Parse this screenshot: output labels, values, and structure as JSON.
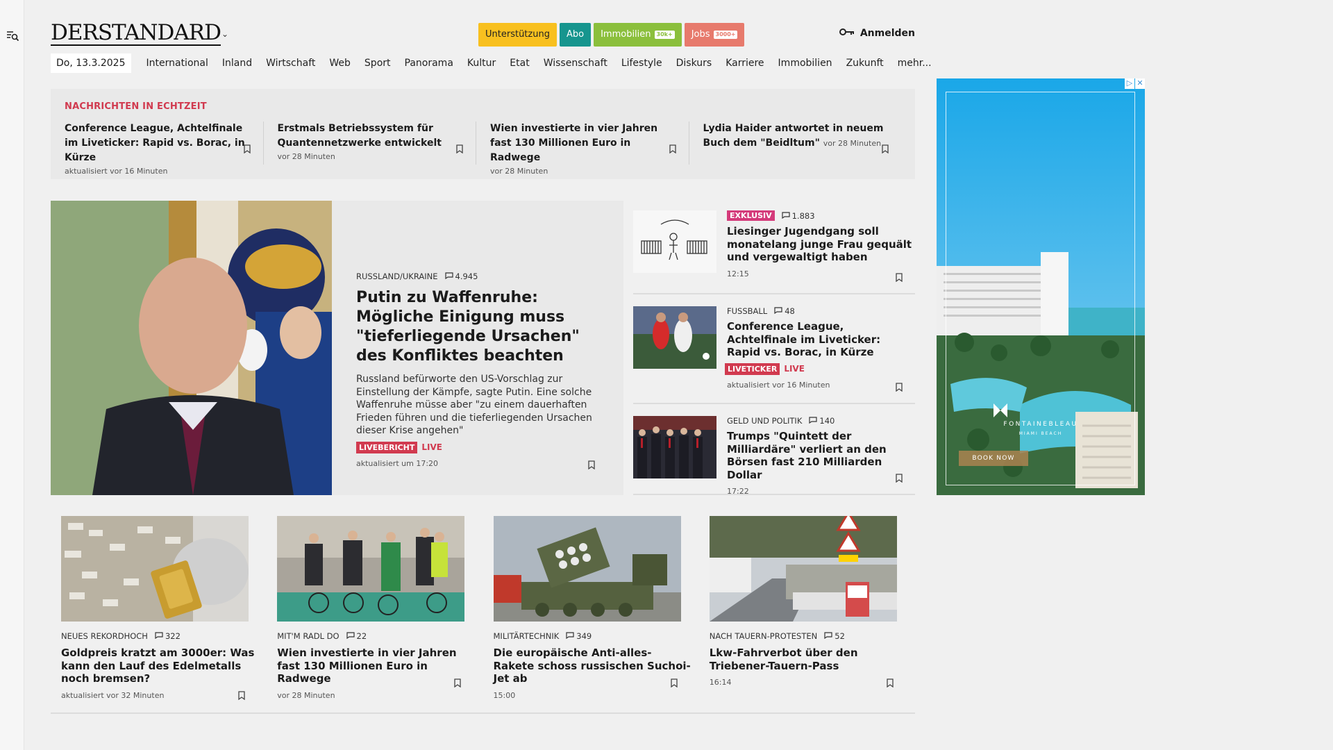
{
  "colors": {
    "accent_red": "#d13a4f",
    "exklusiv": "#d43a7a",
    "support": "#f8c01f",
    "abo": "#16958e",
    "immobilien": "#8bbf3c",
    "jobs": "#e77a6c"
  },
  "header": {
    "logo": "DERSTANDARD",
    "buttons": [
      {
        "label": "Unterstützung",
        "pill": ""
      },
      {
        "label": "Abo",
        "pill": ""
      },
      {
        "label": "Immobilien",
        "pill": "30k+"
      },
      {
        "label": "Jobs",
        "pill": "3000+"
      }
    ],
    "login_label": "Anmelden"
  },
  "nav": {
    "date": "Do, 13.3.2025",
    "items": [
      "International",
      "Inland",
      "Wirtschaft",
      "Web",
      "Sport",
      "Panorama",
      "Kultur",
      "Etat",
      "Wissenschaft",
      "Lifestyle",
      "Diskurs",
      "Karriere",
      "Immobilien",
      "Zukunft",
      "mehr..."
    ]
  },
  "ticker": {
    "heading": "NACHRICHTEN IN ECHTZEIT",
    "items": [
      {
        "title": "Conference League, Achtelfinale im Liveticker: Rapid vs. Borac, in Kürze",
        "meta": "aktualisiert vor 16 Minuten"
      },
      {
        "title": "Erstmals Betriebssystem für Quantennetzwerke entwickelt",
        "meta": "vor 28 Minuten"
      },
      {
        "title": "Wien investierte in vier Jahren fast 130 Millionen Euro in Radwege",
        "meta": "vor 28 Minuten"
      },
      {
        "title": "Lydia Haider antwortet in neuem Buch dem \"Beidltum\"",
        "meta": "vor 28 Minuten"
      }
    ]
  },
  "lead": {
    "kicker": "RUSSLAND/UKRAINE",
    "comments": "4.945",
    "title": "Putin zu Waffenruhe: Mögliche Einigung muss \"tieferliegende Ursachen\" des Konfliktes beachten",
    "teaser": "Russland befürworte den US-Vorschlag zur Einstellung der Kämpfe, sagte Putin. Eine solche Waffenruhe müsse aber \"zu einem dauerhaften Frieden führen und die tieferliegenden Ursachen dieser Krise angehen\"",
    "badge": "LIVEBERICHT",
    "live": "LIVE",
    "meta": "aktualisiert um 17:20"
  },
  "side": [
    {
      "label": "EXKLUSIV",
      "comments": "1.883",
      "title": "Liesinger Jugendgang soll monatelang junge Frau gequält und vergewaltigt haben",
      "meta": "12:15"
    },
    {
      "kicker": "FUSSBALL",
      "comments": "48",
      "title": "Conference League, Achtelfinale im Liveticker: Rapid vs. Borac, in Kürze",
      "badge": "LIVETICKER",
      "live": "LIVE",
      "meta": "aktualisiert vor 16 Minuten"
    },
    {
      "kicker": "GELD UND POLITIK",
      "comments": "140",
      "title": "Trumps \"Quintett der Milliardäre\" verliert an den Börsen fast 210 Milliarden Dollar",
      "meta": "17:22"
    }
  ],
  "ad": {
    "brand": "FONTAINEBLEAU",
    "sub": "MIAMI BEACH",
    "cta": "BOOK NOW"
  },
  "bottom": [
    {
      "kicker": "NEUES REKORDHOCH",
      "comments": "322",
      "title": "Goldpreis kratzt am 3000er: Was kann den Lauf des Edelmetalls noch bremsen?",
      "meta": "aktualisiert vor 32 Minuten"
    },
    {
      "kicker": "MIT'M RADL DO",
      "comments": "22",
      "title": "Wien investierte in vier Jahren fast 130 Millionen Euro in Radwege",
      "meta": "vor 28 Minuten"
    },
    {
      "kicker": "MILITÄRTECHNIK",
      "comments": "349",
      "title": "Die europäische Anti-alles-Rakete schoss russischen Suchoi-Jet ab",
      "meta": "15:00"
    },
    {
      "kicker": "NACH TAUERN-PROTESTEN",
      "comments": "52",
      "title": "Lkw-Fahrverbot über den Triebener-Tauern-Pass",
      "meta": "16:14"
    }
  ]
}
